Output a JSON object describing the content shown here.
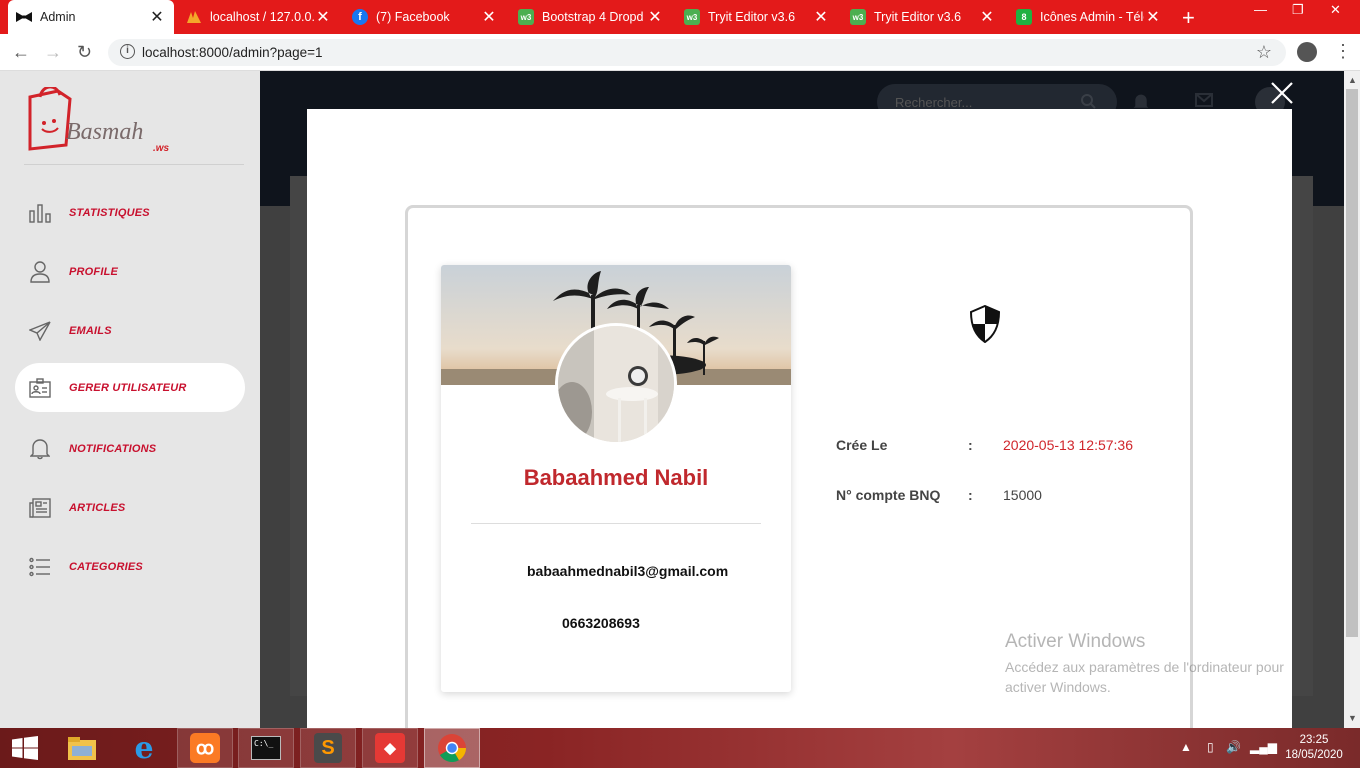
{
  "browser": {
    "tabs": [
      {
        "label": "Admin",
        "icon": "bow-tie-icon",
        "active": true
      },
      {
        "label": "localhost / 127.0.0.",
        "icon": "phpmyadmin-icon"
      },
      {
        "label": "(7) Facebook",
        "icon": "facebook-icon"
      },
      {
        "label": "Bootstrap 4 Dropd",
        "icon": "w3schools-icon"
      },
      {
        "label": "Tryit Editor v3.6",
        "icon": "w3schools-icon"
      },
      {
        "label": "Tryit Editor v3.6",
        "icon": "w3schools-icon"
      },
      {
        "label": "Icônes Admin - Télé",
        "icon": "icons8-icon"
      }
    ],
    "url": "localhost:8000/admin?page=1"
  },
  "sidebar": {
    "logo_text": "Basmah",
    "logo_suffix": ".ws",
    "items": [
      {
        "label": "STATISTIQUES",
        "icon": "bar-chart-icon"
      },
      {
        "label": "PROFILE",
        "icon": "user-icon"
      },
      {
        "label": "EMAILS",
        "icon": "paper-plane-icon"
      },
      {
        "label": "GERER UTILISATEUR",
        "icon": "id-card-icon",
        "active": true
      },
      {
        "label": "NOTIFICATIONS",
        "icon": "bell-icon"
      },
      {
        "label": "ARTICLES",
        "icon": "newspaper-icon"
      },
      {
        "label": "CATEGORIES",
        "icon": "list-icon"
      }
    ]
  },
  "header": {
    "search_placeholder": "Rechercher..."
  },
  "modal": {
    "user": {
      "name": "Babaahmed Nabil",
      "email": "babaahmednabil3@gmail.com",
      "phone": "0663208693"
    },
    "details": [
      {
        "label": "Crée Le",
        "colon": ":",
        "value": "2020-05-13 12:57:36"
      },
      {
        "label": "N° compte BNQ",
        "colon": ":",
        "value": "15000"
      }
    ]
  },
  "watermark": {
    "title": "Activer Windows",
    "subtitle": "Accédez aux paramètres de l'ordinateur pour activer Windows."
  },
  "taskbar": {
    "time": "23:25",
    "date": "18/05/2020"
  },
  "colors": {
    "brand_red": "#c8102e",
    "tab_bar": "#e31a1a",
    "name_red": "#c0282d"
  }
}
